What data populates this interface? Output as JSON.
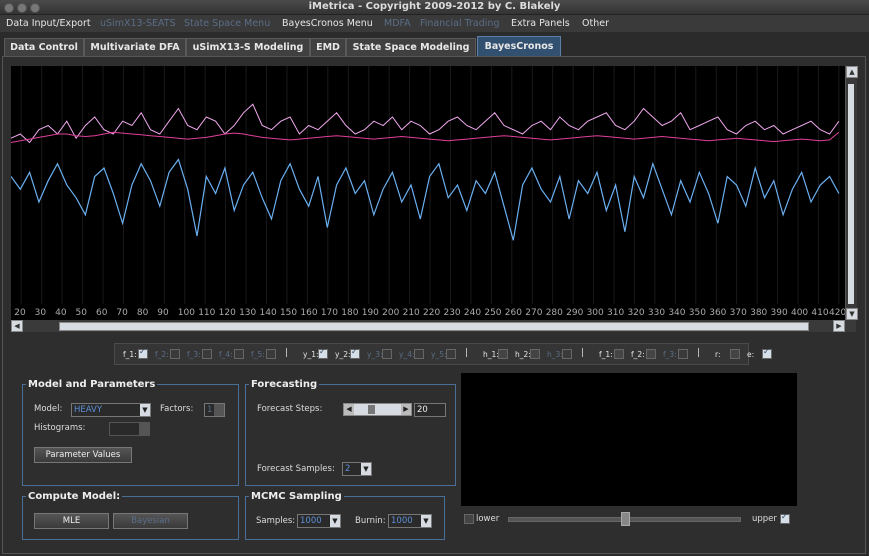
{
  "window": {
    "title": "iMetrica - Copyright 2009-2012 by C. Blakely"
  },
  "menubar": [
    {
      "label": "Data Input/Export",
      "enabled": true
    },
    {
      "label": "uSimX13-SEATS",
      "enabled": false
    },
    {
      "label": "State Space Menu",
      "enabled": false
    },
    {
      "label": "BayesCronos Menu",
      "enabled": true
    },
    {
      "label": "MDFA",
      "enabled": false
    },
    {
      "label": "Financial Trading",
      "enabled": false
    },
    {
      "label": "Extra Panels",
      "enabled": true
    },
    {
      "label": "Other",
      "enabled": true
    }
  ],
  "tabs": [
    {
      "label": "Data Control",
      "active": false
    },
    {
      "label": "Multivariate DFA",
      "active": false
    },
    {
      "label": "uSimX13-S Modeling",
      "active": false
    },
    {
      "label": "EMD",
      "active": false
    },
    {
      "label": "State Space Modeling",
      "active": false
    },
    {
      "label": "BayesCronos",
      "active": true
    }
  ],
  "chart_data": {
    "type": "line",
    "x_ticks": [
      "20",
      "30",
      "40",
      "50",
      "60",
      "70",
      "80",
      "90",
      "100",
      "110",
      "120",
      "130",
      "140",
      "150",
      "160",
      "170",
      "180",
      "190",
      "200",
      "210",
      "220",
      "230",
      "240",
      "250",
      "260",
      "270",
      "280",
      "290",
      "300",
      "310",
      "320",
      "330",
      "340",
      "350",
      "360",
      "370",
      "380",
      "390",
      "400",
      "410",
      "420"
    ],
    "xlim": [
      15,
      423
    ],
    "ylim": [
      -1.6,
      1.2
    ],
    "series": [
      {
        "color": "#6aaff0",
        "values": [
          -0.1,
          -0.25,
          -0.05,
          -0.4,
          -0.15,
          0.05,
          -0.2,
          -0.35,
          -0.55,
          -0.1,
          0.0,
          -0.3,
          -0.65,
          -0.2,
          0.05,
          -0.15,
          -0.45,
          -0.05,
          0.1,
          -0.25,
          -0.8,
          -0.1,
          -0.3,
          0.0,
          -0.5,
          -0.2,
          -0.05,
          -0.35,
          -0.6,
          -0.15,
          0.05,
          -0.25,
          -0.45,
          -0.1,
          -0.7,
          -0.2,
          0.0,
          -0.3,
          -0.15,
          -0.55,
          -0.25,
          -0.05,
          -0.4,
          -0.2,
          -0.6,
          -0.1,
          0.05,
          -0.35,
          -0.2,
          -0.5,
          -0.15,
          -0.3,
          -0.05,
          -0.45,
          -0.85,
          -0.2,
          0.0,
          -0.25,
          -0.4,
          -0.1,
          -0.6,
          -0.15,
          -0.3,
          -0.05,
          -0.5,
          -0.2,
          -0.75,
          -0.1,
          -0.35,
          0.05,
          -0.25,
          -0.55,
          -0.15,
          -0.4,
          -0.05,
          -0.3,
          -0.65,
          -0.1,
          -0.2,
          -0.45,
          0.0,
          -0.35,
          -0.15,
          -0.55,
          -0.25,
          -0.05,
          -0.4,
          -0.2,
          -0.1,
          -0.3
        ]
      },
      {
        "color": "#f0a8ee",
        "values": [
          0.35,
          0.4,
          0.3,
          0.45,
          0.5,
          0.4,
          0.55,
          0.35,
          0.5,
          0.6,
          0.45,
          0.4,
          0.55,
          0.5,
          0.65,
          0.45,
          0.4,
          0.55,
          0.7,
          0.5,
          0.45,
          0.6,
          0.55,
          0.4,
          0.5,
          0.65,
          0.75,
          0.5,
          0.45,
          0.55,
          0.6,
          0.4,
          0.5,
          0.45,
          0.55,
          0.65,
          0.5,
          0.4,
          0.45,
          0.55,
          0.5,
          0.6,
          0.45,
          0.55,
          0.5,
          0.4,
          0.45,
          0.55,
          0.6,
          0.5,
          0.45,
          0.55,
          0.65,
          0.5,
          0.45,
          0.4,
          0.5,
          0.55,
          0.45,
          0.6,
          0.5,
          0.45,
          0.55,
          0.6,
          0.65,
          0.5,
          0.45,
          0.55,
          0.7,
          0.6,
          0.5,
          0.55,
          0.65,
          0.45,
          0.5,
          0.55,
          0.6,
          0.45,
          0.4,
          0.5,
          0.55,
          0.45,
          0.5,
          0.4,
          0.45,
          0.5,
          0.55,
          0.45,
          0.4,
          0.55
        ]
      },
      {
        "color": "#e0409a",
        "values": [
          0.3,
          0.32,
          0.34,
          0.36,
          0.38,
          0.4,
          0.4,
          0.38,
          0.37,
          0.38,
          0.4,
          0.42,
          0.41,
          0.4,
          0.39,
          0.38,
          0.37,
          0.36,
          0.35,
          0.34,
          0.35,
          0.36,
          0.38,
          0.4,
          0.41,
          0.4,
          0.38,
          0.36,
          0.35,
          0.34,
          0.33,
          0.34,
          0.35,
          0.36,
          0.37,
          0.38,
          0.37,
          0.36,
          0.35,
          0.34,
          0.35,
          0.36,
          0.37,
          0.36,
          0.35,
          0.34,
          0.33,
          0.32,
          0.33,
          0.34,
          0.35,
          0.36,
          0.37,
          0.38,
          0.37,
          0.36,
          0.35,
          0.34,
          0.33,
          0.34,
          0.35,
          0.36,
          0.37,
          0.38,
          0.37,
          0.36,
          0.35,
          0.34,
          0.35,
          0.36,
          0.37,
          0.36,
          0.35,
          0.34,
          0.33,
          0.32,
          0.33,
          0.34,
          0.35,
          0.34,
          0.33,
          0.32,
          0.31,
          0.32,
          0.33,
          0.34,
          0.33,
          0.32,
          0.33,
          0.42
        ]
      }
    ]
  },
  "series_toggles": [
    {
      "label": "f_1:",
      "checked": true,
      "enabled": true
    },
    {
      "label": "f_2:",
      "checked": false,
      "enabled": false
    },
    {
      "label": "f_3:",
      "checked": false,
      "enabled": false
    },
    {
      "label": "f_4:",
      "checked": false,
      "enabled": false
    },
    {
      "label": "f_5:",
      "checked": false,
      "enabled": false
    },
    {
      "label": "y_1:",
      "checked": true,
      "enabled": true
    },
    {
      "label": "y_2:",
      "checked": true,
      "enabled": true
    },
    {
      "label": "y_3:",
      "checked": false,
      "enabled": false
    },
    {
      "label": "y_4:",
      "checked": false,
      "enabled": false
    },
    {
      "label": "y_5:",
      "checked": false,
      "enabled": false
    },
    {
      "label": "h_1:",
      "checked": false,
      "enabled": true
    },
    {
      "label": "h_2:",
      "checked": false,
      "enabled": true
    },
    {
      "label": "h_3:",
      "checked": false,
      "enabled": false
    },
    {
      "label": "f_1:",
      "checked": false,
      "enabled": true
    },
    {
      "label": "f_2:",
      "checked": false,
      "enabled": true
    },
    {
      "label": "f_3:",
      "checked": false,
      "enabled": false
    },
    {
      "label": "r:",
      "checked": false,
      "enabled": true
    },
    {
      "label": "e:",
      "checked": true,
      "enabled": true
    }
  ],
  "model_panel": {
    "title": "Model and Parameters",
    "model_label": "Model:",
    "model_value": "HEAVY",
    "factors_label": "Factors:",
    "factors_value": "1",
    "histograms_label": "Histograms:",
    "param_button": "Parameter Values"
  },
  "forecast_panel": {
    "title": "Forecasting",
    "steps_label": "Forecast Steps:",
    "steps_value": "20",
    "samples_label": "Forecast Samples:",
    "samples_value": "2"
  },
  "compute_panel": {
    "title": "Compute Model:",
    "mle_button": "MLE",
    "bayesian_button": "Bayesian"
  },
  "mcmc_panel": {
    "title": "MCMC Sampling",
    "samples_label": "Samples:",
    "samples_value": "1000",
    "burnin_label": "Burnin:",
    "burnin_value": "1000"
  },
  "slider": {
    "lower_label": "lower",
    "upper_label": "upper",
    "upper_checked": true,
    "lower_checked": false,
    "value": 0.5
  }
}
